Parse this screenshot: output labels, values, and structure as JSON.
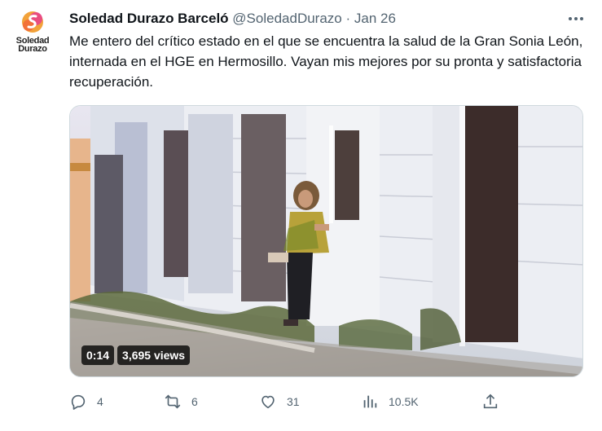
{
  "author": {
    "name": "Soledad Durazo Barceló",
    "handle": "@SoledadDurazo",
    "separator": "·",
    "date": "Jan 26",
    "logo_text_line1": "Soledad",
    "logo_text_line2": "Durazo"
  },
  "tweet": {
    "text": "Me entero del crítico estado en el que se encuentra la salud de la Gran Sonia León, internada en el HGE en Hermosillo. Vayan mis mejores por su pronta y satisfactoria recuperación."
  },
  "video": {
    "duration": "0:14",
    "views": "3,695 views"
  },
  "actions": {
    "replies": "4",
    "retweets": "6",
    "likes": "31",
    "views": "10.5K"
  },
  "colors": {
    "text": "#0f1419",
    "secondary": "#536471",
    "logo_orange": "#f28c28",
    "logo_pink": "#e83e8c"
  }
}
